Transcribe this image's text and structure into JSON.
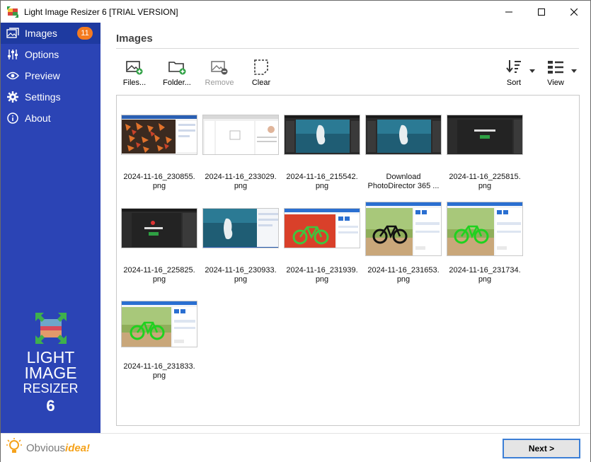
{
  "window": {
    "title": "Light Image Resizer 6  [TRIAL VERSION]"
  },
  "sidebar": {
    "items": [
      {
        "label": "Images",
        "icon": "images-icon",
        "badge": "11",
        "active": true
      },
      {
        "label": "Options",
        "icon": "sliders-icon"
      },
      {
        "label": "Preview",
        "icon": "eye-icon"
      },
      {
        "label": "Settings",
        "icon": "gear-icon"
      },
      {
        "label": "About",
        "icon": "info-icon"
      }
    ],
    "logo": {
      "line1": "LIGHT",
      "line2": "IMAGE",
      "line3": "RESIZER",
      "line4": "6"
    },
    "brand": {
      "prefix": "Obvious",
      "suffix": "idea!"
    }
  },
  "main": {
    "title": "Images",
    "toolbar": {
      "files": "Files...",
      "folder": "Folder...",
      "remove": "Remove",
      "clear": "Clear",
      "sort": "Sort",
      "view": "View"
    },
    "images": [
      {
        "name": "2024-11-16_230855.",
        "ext": "png",
        "kind": "leaves"
      },
      {
        "name": "2024-11-16_233029.",
        "ext": "png",
        "kind": "dialog"
      },
      {
        "name": "2024-11-16_215542.",
        "ext": "png",
        "kind": "dark-ocean"
      },
      {
        "name": "Download",
        "ext": "PhotoDirector 365 ...",
        "kind": "dark-ocean"
      },
      {
        "name": "2024-11-16_225815.",
        "ext": "png",
        "kind": "dark-page"
      },
      {
        "name": "2024-11-16_225825.",
        "ext": "png",
        "kind": "dark-page"
      },
      {
        "name": "2024-11-16_230933.",
        "ext": "png",
        "kind": "ocean"
      },
      {
        "name": "2024-11-16_231939.",
        "ext": "png",
        "kind": "bike-red"
      },
      {
        "name": "2024-11-16_231653.",
        "ext": "png",
        "kind": "bike-black"
      },
      {
        "name": "2024-11-16_231734.",
        "ext": "png",
        "kind": "bike-green"
      },
      {
        "name": "2024-11-16_231833.",
        "ext": "png",
        "kind": "bike-green"
      }
    ]
  },
  "footer": {
    "next": "Next >"
  },
  "colors": {
    "sidebar": "#2b44b5",
    "accent": "#f47b20",
    "button_border": "#3c7fd6"
  }
}
